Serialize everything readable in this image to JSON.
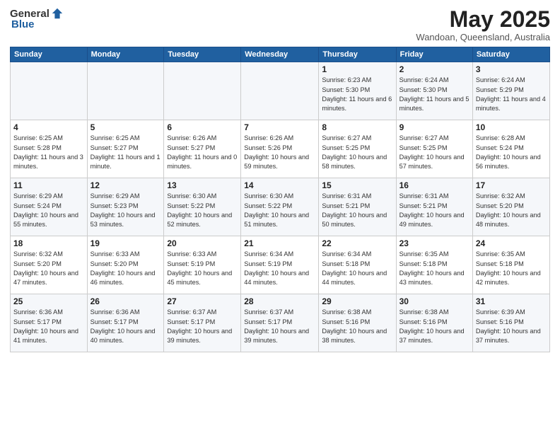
{
  "header": {
    "logo_general": "General",
    "logo_blue": "Blue",
    "month_title": "May 2025",
    "location": "Wandoan, Queensland, Australia"
  },
  "weekdays": [
    "Sunday",
    "Monday",
    "Tuesday",
    "Wednesday",
    "Thursday",
    "Friday",
    "Saturday"
  ],
  "weeks": [
    [
      {
        "day": "",
        "info": ""
      },
      {
        "day": "",
        "info": ""
      },
      {
        "day": "",
        "info": ""
      },
      {
        "day": "",
        "info": ""
      },
      {
        "day": "1",
        "info": "Sunrise: 6:23 AM\nSunset: 5:30 PM\nDaylight: 11 hours\nand 6 minutes."
      },
      {
        "day": "2",
        "info": "Sunrise: 6:24 AM\nSunset: 5:30 PM\nDaylight: 11 hours\nand 5 minutes."
      },
      {
        "day": "3",
        "info": "Sunrise: 6:24 AM\nSunset: 5:29 PM\nDaylight: 11 hours\nand 4 minutes."
      }
    ],
    [
      {
        "day": "4",
        "info": "Sunrise: 6:25 AM\nSunset: 5:28 PM\nDaylight: 11 hours\nand 3 minutes."
      },
      {
        "day": "5",
        "info": "Sunrise: 6:25 AM\nSunset: 5:27 PM\nDaylight: 11 hours\nand 1 minute."
      },
      {
        "day": "6",
        "info": "Sunrise: 6:26 AM\nSunset: 5:27 PM\nDaylight: 11 hours\nand 0 minutes."
      },
      {
        "day": "7",
        "info": "Sunrise: 6:26 AM\nSunset: 5:26 PM\nDaylight: 10 hours\nand 59 minutes."
      },
      {
        "day": "8",
        "info": "Sunrise: 6:27 AM\nSunset: 5:25 PM\nDaylight: 10 hours\nand 58 minutes."
      },
      {
        "day": "9",
        "info": "Sunrise: 6:27 AM\nSunset: 5:25 PM\nDaylight: 10 hours\nand 57 minutes."
      },
      {
        "day": "10",
        "info": "Sunrise: 6:28 AM\nSunset: 5:24 PM\nDaylight: 10 hours\nand 56 minutes."
      }
    ],
    [
      {
        "day": "11",
        "info": "Sunrise: 6:29 AM\nSunset: 5:24 PM\nDaylight: 10 hours\nand 55 minutes."
      },
      {
        "day": "12",
        "info": "Sunrise: 6:29 AM\nSunset: 5:23 PM\nDaylight: 10 hours\nand 53 minutes."
      },
      {
        "day": "13",
        "info": "Sunrise: 6:30 AM\nSunset: 5:22 PM\nDaylight: 10 hours\nand 52 minutes."
      },
      {
        "day": "14",
        "info": "Sunrise: 6:30 AM\nSunset: 5:22 PM\nDaylight: 10 hours\nand 51 minutes."
      },
      {
        "day": "15",
        "info": "Sunrise: 6:31 AM\nSunset: 5:21 PM\nDaylight: 10 hours\nand 50 minutes."
      },
      {
        "day": "16",
        "info": "Sunrise: 6:31 AM\nSunset: 5:21 PM\nDaylight: 10 hours\nand 49 minutes."
      },
      {
        "day": "17",
        "info": "Sunrise: 6:32 AM\nSunset: 5:20 PM\nDaylight: 10 hours\nand 48 minutes."
      }
    ],
    [
      {
        "day": "18",
        "info": "Sunrise: 6:32 AM\nSunset: 5:20 PM\nDaylight: 10 hours\nand 47 minutes."
      },
      {
        "day": "19",
        "info": "Sunrise: 6:33 AM\nSunset: 5:20 PM\nDaylight: 10 hours\nand 46 minutes."
      },
      {
        "day": "20",
        "info": "Sunrise: 6:33 AM\nSunset: 5:19 PM\nDaylight: 10 hours\nand 45 minutes."
      },
      {
        "day": "21",
        "info": "Sunrise: 6:34 AM\nSunset: 5:19 PM\nDaylight: 10 hours\nand 44 minutes."
      },
      {
        "day": "22",
        "info": "Sunrise: 6:34 AM\nSunset: 5:18 PM\nDaylight: 10 hours\nand 44 minutes."
      },
      {
        "day": "23",
        "info": "Sunrise: 6:35 AM\nSunset: 5:18 PM\nDaylight: 10 hours\nand 43 minutes."
      },
      {
        "day": "24",
        "info": "Sunrise: 6:35 AM\nSunset: 5:18 PM\nDaylight: 10 hours\nand 42 minutes."
      }
    ],
    [
      {
        "day": "25",
        "info": "Sunrise: 6:36 AM\nSunset: 5:17 PM\nDaylight: 10 hours\nand 41 minutes."
      },
      {
        "day": "26",
        "info": "Sunrise: 6:36 AM\nSunset: 5:17 PM\nDaylight: 10 hours\nand 40 minutes."
      },
      {
        "day": "27",
        "info": "Sunrise: 6:37 AM\nSunset: 5:17 PM\nDaylight: 10 hours\nand 39 minutes."
      },
      {
        "day": "28",
        "info": "Sunrise: 6:37 AM\nSunset: 5:17 PM\nDaylight: 10 hours\nand 39 minutes."
      },
      {
        "day": "29",
        "info": "Sunrise: 6:38 AM\nSunset: 5:16 PM\nDaylight: 10 hours\nand 38 minutes."
      },
      {
        "day": "30",
        "info": "Sunrise: 6:38 AM\nSunset: 5:16 PM\nDaylight: 10 hours\nand 37 minutes."
      },
      {
        "day": "31",
        "info": "Sunrise: 6:39 AM\nSunset: 5:16 PM\nDaylight: 10 hours\nand 37 minutes."
      }
    ]
  ]
}
